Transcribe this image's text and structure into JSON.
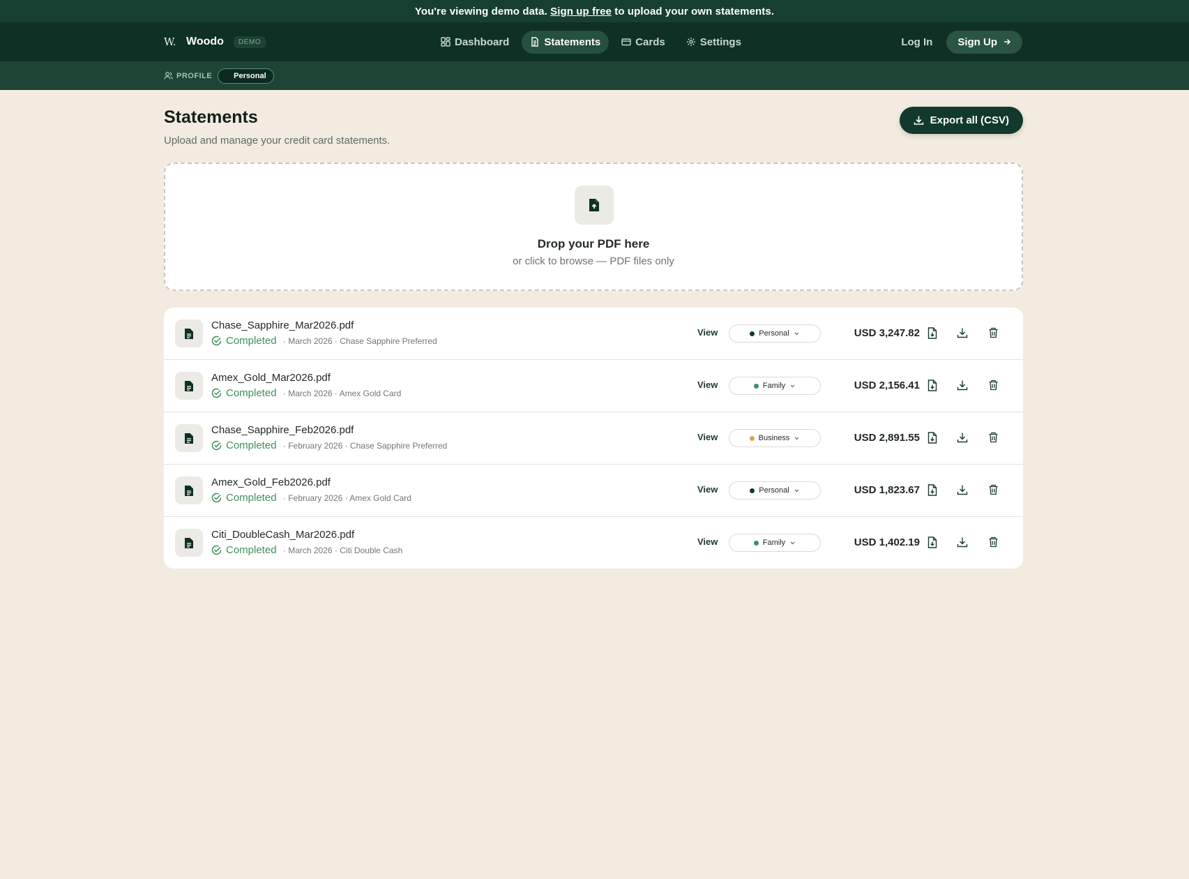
{
  "banner": {
    "prefix": "You're viewing demo data. ",
    "link": "Sign up free",
    "suffix": " to upload your own statements."
  },
  "nav": {
    "logo_glyph": "W.",
    "brand": "Woodo",
    "badge": "DEMO",
    "items": [
      {
        "label": "Dashboard",
        "icon": "grid-icon",
        "active": false
      },
      {
        "label": "Statements",
        "icon": "document-icon",
        "active": true
      },
      {
        "label": "Cards",
        "icon": "card-icon",
        "active": false
      },
      {
        "label": "Settings",
        "icon": "gear-icon",
        "active": false
      }
    ],
    "login": "Log In",
    "signup": "Sign Up"
  },
  "profile_bar": {
    "label": "PROFILE",
    "current": "Personal"
  },
  "page": {
    "title": "Statements",
    "subtitle": "Upload and manage your credit card statements.",
    "export_label": "Export all (CSV)"
  },
  "dropzone": {
    "title": "Drop your PDF here",
    "subtitle": "or click to browse — PDF files only"
  },
  "colors": {
    "accent": "#0f3024",
    "personal": "#0f3b2a",
    "family": "#3f8f68",
    "business": "#d6a74a",
    "completed": "#3f8f5a"
  },
  "statements": [
    {
      "file": "Chase_Sapphire_Mar2026.pdf",
      "status": "Completed",
      "period": " · March 2026",
      "card": " · Chase Sapphire Preferred",
      "view": "View",
      "profile": "Personal",
      "profile_color": "#0f3b2a",
      "amount": "USD 3,247.82"
    },
    {
      "file": "Amex_Gold_Mar2026.pdf",
      "status": "Completed",
      "period": " · March 2026",
      "card": " · Amex Gold Card",
      "view": "View",
      "profile": "Family",
      "profile_color": "#3f8f68",
      "amount": "USD 2,156.41"
    },
    {
      "file": "Chase_Sapphire_Feb2026.pdf",
      "status": "Completed",
      "period": " · February 2026",
      "card": " · Chase Sapphire Preferred",
      "view": "View",
      "profile": "Business",
      "profile_color": "#d6a74a",
      "amount": "USD 2,891.55"
    },
    {
      "file": "Amex_Gold_Feb2026.pdf",
      "status": "Completed",
      "period": " · February 2026",
      "card": " · Amex Gold Card",
      "view": "View",
      "profile": "Personal",
      "profile_color": "#0f3b2a",
      "amount": "USD 1,823.67"
    },
    {
      "file": "Citi_DoubleCash_Mar2026.pdf",
      "status": "Completed",
      "period": " · March 2026",
      "card": " · Citi Double Cash",
      "view": "View",
      "profile": "Family",
      "profile_color": "#3f8f68",
      "amount": "USD 1,402.19"
    }
  ]
}
